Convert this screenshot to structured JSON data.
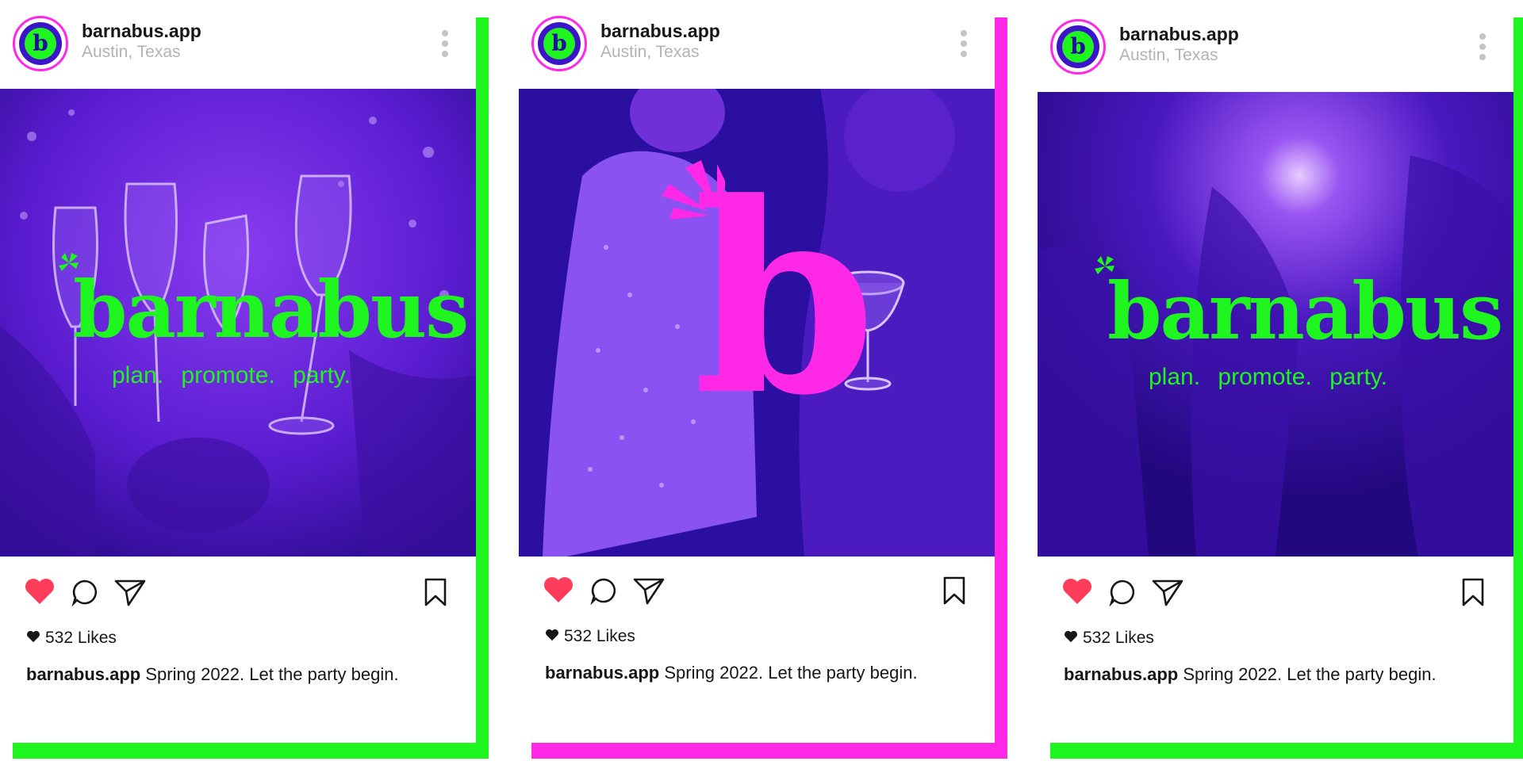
{
  "colors": {
    "green": "#1ff51f",
    "magenta": "#ff28e6",
    "deep_purple": "#2a0fa0",
    "violet": "#7a2fe0",
    "heart_red": "#ff3d5a"
  },
  "posts": [
    {
      "accent": "#1ff51f",
      "username": "barnabus.app",
      "location": "Austin, Texas",
      "likes": "532 Likes",
      "caption_user": "barnabus.app",
      "caption_text": "Spring 2022. Let the party begin.",
      "logo_text": "barnabus",
      "tagline": "plan. promote. party.",
      "avatar_letter": "b",
      "photo_desc_icon": "champagne-toast"
    },
    {
      "accent": "#ff28e6",
      "username": "barnabus.app",
      "location": "Austin, Texas",
      "likes": "532 Likes",
      "caption_user": "barnabus.app",
      "caption_text": "Spring 2022. Let the party begin.",
      "logo_letter": "b",
      "avatar_letter": "b",
      "photo_desc_icon": "party-guests"
    },
    {
      "accent": "#1ff51f",
      "username": "barnabus.app",
      "location": "Austin, Texas",
      "likes": "532 Likes",
      "caption_user": "barnabus.app",
      "caption_text": "Spring 2022. Let the party begin.",
      "logo_text": "barnabus",
      "tagline": "plan. promote. party.",
      "avatar_letter": "b",
      "photo_desc_icon": "dance-floor"
    }
  ],
  "icons": {
    "like": "heart-icon",
    "comment": "comment-icon",
    "share": "send-icon",
    "save": "bookmark-icon",
    "menu": "more-vertical-icon"
  }
}
